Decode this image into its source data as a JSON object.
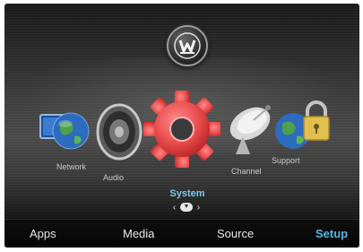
{
  "menu": {
    "icons": [
      {
        "id": "network",
        "label": "Network",
        "icon": "globe-monitor-icon"
      },
      {
        "id": "audio",
        "label": "Audio",
        "icon": "speaker-icon"
      },
      {
        "id": "system",
        "label": "System",
        "icon": "gear-icon",
        "selected": true
      },
      {
        "id": "channel",
        "label": "Channel",
        "icon": "satellite-dish-icon"
      },
      {
        "id": "support",
        "label": "Support",
        "icon": "globe-lock-icon"
      }
    ],
    "selected_label": "System",
    "nav_left": "‹",
    "nav_down": "▼",
    "nav_right": "›"
  },
  "tabs": [
    {
      "label": "Apps",
      "active": false
    },
    {
      "label": "Media",
      "active": false
    },
    {
      "label": "Source",
      "active": false
    },
    {
      "label": "Setup",
      "active": true
    }
  ],
  "colors": {
    "accent": "#4fb8e8",
    "selected_icon": "#e84a4a",
    "text": "#e8e8e8"
  },
  "logo": {
    "icon": "westinghouse-w-logo"
  }
}
